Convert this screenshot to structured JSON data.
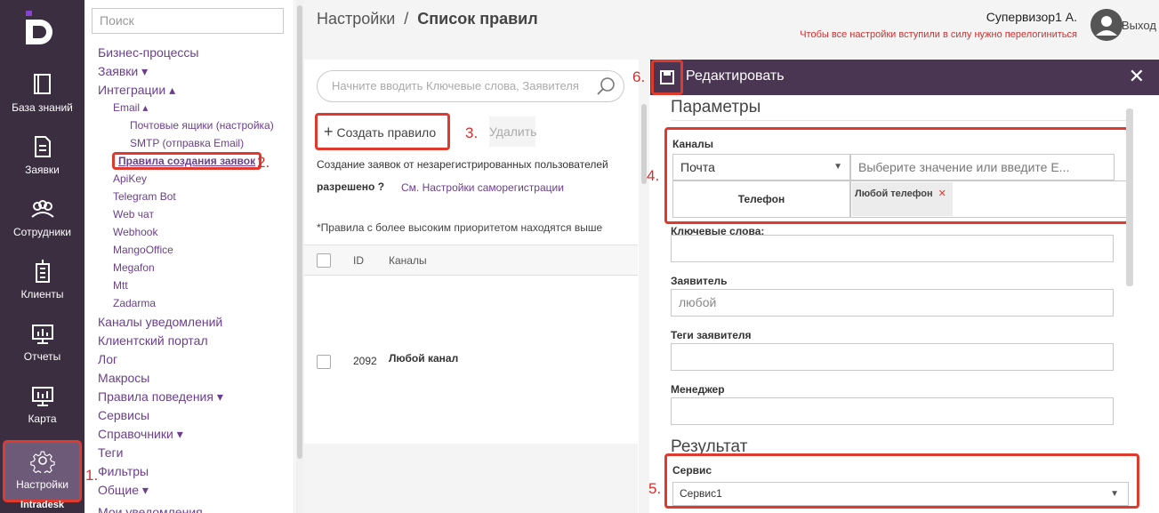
{
  "nav_rail": {
    "items": [
      {
        "label": "База знаний",
        "icon": "book-icon"
      },
      {
        "label": "Заявки",
        "icon": "document-icon"
      },
      {
        "label": "Сотрудники",
        "icon": "people-icon"
      },
      {
        "label": "Клиенты",
        "icon": "building-icon"
      },
      {
        "label": "Отчеты",
        "icon": "monitor-chart-icon"
      },
      {
        "label": "Карта",
        "icon": "monitor-map-icon"
      },
      {
        "label": "Настройки",
        "icon": "gear-icon",
        "active": true
      }
    ],
    "footer": "Intradesk"
  },
  "tree": {
    "search_placeholder": "Поиск",
    "items": [
      "Бизнес-процессы",
      "Заявки ▾",
      "Интеграции ▴",
      "Email ▴",
      "Почтовые ящики (настройка)",
      "SMTP (отправка Email)",
      "Правила создания заявок",
      "ApiKey",
      "Telegram Bot",
      "Web чат",
      "Webhook",
      "MangoOffice",
      "Megafon",
      "Mtt",
      "Zadarma",
      "Каналы уведомлений",
      "Клиентский портал",
      "Лог",
      "Макросы",
      "Правила поведения ▾",
      "Сервисы",
      "Справочники ▾",
      "Теги",
      "Фильтры",
      "Общие ▾",
      "Мои уведомления"
    ]
  },
  "header": {
    "breadcrumb_root": "Настройки",
    "breadcrumb_sep": "/",
    "breadcrumb_current": "Список правил",
    "user_name": "Супервизор1 А.",
    "relogin_notice": "Чтобы все настройки вступили в силу нужно перелогиниться",
    "logout": "Выход"
  },
  "list": {
    "search_placeholder": "Начните вводить Ключевые слова, Заявителя",
    "create_label": "Создать правило",
    "delete_label": "Удалить",
    "info_text": "Создание заявок от незарегистрированных пользователей",
    "allowed_text": "разрешено",
    "allowed_help": "?",
    "selfreg_link": "См. Настройки саморегистрации",
    "priority_note": "*Правила с более высоким приоритетом находятся выше",
    "columns": [
      "ID",
      "Каналы"
    ],
    "rows": [
      {
        "id": "2092",
        "channel": "Любой канал"
      }
    ]
  },
  "editor": {
    "title": "Редактировать",
    "params_title": "Параметры",
    "channels_label": "Каналы",
    "channel_type": "Почта",
    "channel_placeholder": "Выберите значение или введите E...",
    "channel_row_label": "Телефон",
    "channel_tag": "Любой телефон",
    "keywords_label": "Ключевые слова:",
    "applicant_label": "Заявитель",
    "applicant_placeholder": "любой",
    "applicant_tags_label": "Теги заявителя",
    "manager_label": "Менеджер",
    "result_title": "Результат",
    "service_label": "Сервис",
    "service_value": "Сервис1"
  },
  "step_markers": [
    "1.",
    "2.",
    "3.",
    "4.",
    "5.",
    "6."
  ],
  "colors": {
    "rail": "#3a2e40",
    "link": "#6c3e8f",
    "editor_header": "#4a3552",
    "highlight": "#e03a2f"
  }
}
